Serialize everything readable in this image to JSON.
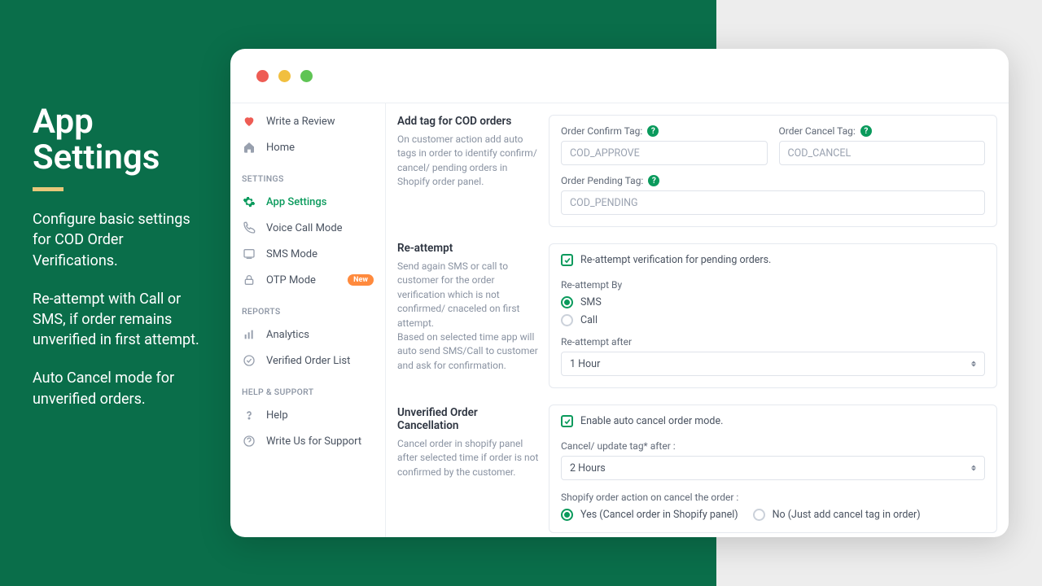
{
  "hero": {
    "title_l1": "App",
    "title_l2": "Settings",
    "p1": "Configure basic settings for COD Order Verifications.",
    "p2": "Re-attempt with Call or SMS, if order remains unverified in first attempt.",
    "p3": "Auto Cancel mode for unverified orders."
  },
  "sidebar": {
    "write_review": "Write a Review",
    "home": "Home",
    "section_settings": "SETTINGS",
    "app_settings": "App Settings",
    "voice_call": "Voice Call Mode",
    "sms_mode": "SMS Mode",
    "otp_mode": "OTP Mode",
    "badge_new": "New",
    "section_reports": "REPORTS",
    "analytics": "Analytics",
    "verified_list": "Verified Order List",
    "section_help": "HELP & SUPPORT",
    "help": "Help",
    "write_us": "Write Us for Support"
  },
  "tags": {
    "title": "Add tag for COD orders",
    "desc": "On customer action add auto tags in order to identify confirm/ cancel/ pending orders in Shopify order panel.",
    "confirm_label": "Order Confirm Tag:",
    "confirm_value": "COD_APPROVE",
    "cancel_label": "Order Cancel Tag:",
    "cancel_value": "COD_CANCEL",
    "pending_label": "Order Pending Tag:",
    "pending_value": "COD_PENDING"
  },
  "reattempt": {
    "title": "Re-attempt",
    "desc1": "Send again SMS or call to customer for the order verification which is not confirmed/ cnaceled on first attempt.",
    "desc2": "Based on selected time app will auto send SMS/Call to customer and ask for confirmation.",
    "checkbox": "Re-attempt verification for pending orders.",
    "by_label": "Re-attempt By",
    "opt_sms": "SMS",
    "opt_call": "Call",
    "after_label": "Re-attempt after",
    "after_value": "1 Hour"
  },
  "cancel": {
    "title": "Unverified Order Cancellation",
    "desc": "Cancel order in shopify panel after selected time if order is not confirmed by the customer.",
    "checkbox": "Enable auto cancel order mode.",
    "after_label": "Cancel/ update tag* after :",
    "after_value": "2 Hours",
    "action_label": "Shopify order action on cancel the order :",
    "opt_yes": "Yes (Cancel order in Shopify panel)",
    "opt_no": "No (Just add cancel tag in order)"
  }
}
